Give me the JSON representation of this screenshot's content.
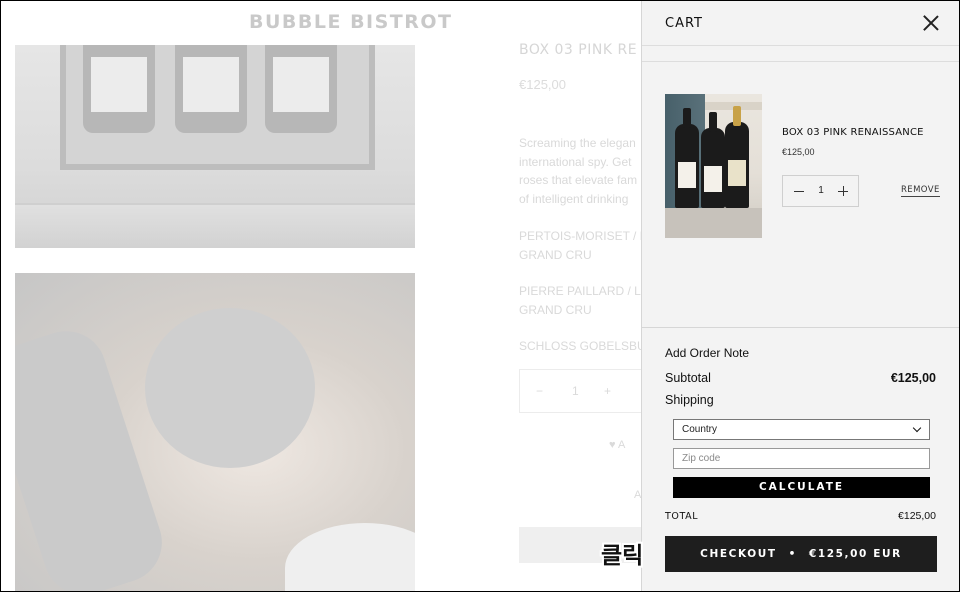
{
  "page": {
    "brand": "BUBBLE BISTROT",
    "product_title": "BOX 03 PINK RE",
    "product_price": "€125,00",
    "description_lines": [
      "Screaming the elegan",
      "international spy. Get",
      "roses that elevate fam",
      "of intelligent drinking"
    ],
    "wines": [
      {
        "line1": "PERTOIS-MORISET / L",
        "line2": "GRAND CRU"
      },
      {
        "line1": "PIERRE PAILLARD / L",
        "line2": "GRAND CRU"
      },
      {
        "line1": "SCHLOSS GOBELSBU",
        "line2": ""
      }
    ],
    "stepper": {
      "minus": "−",
      "value": "1",
      "plus": "+"
    },
    "ghost_text_1": "♥ A",
    "ghost_text_2": "A"
  },
  "overlay": {
    "click_label": "클릭"
  },
  "cart": {
    "title": "CART",
    "item": {
      "name": "BOX 03 PINK RENAISSANCE",
      "price": "€125,00",
      "quantity": "1",
      "remove_label": "REMOVE"
    },
    "order_note_label": "Add Order Note",
    "subtotal_label": "Subtotal",
    "subtotal_value": "€125,00",
    "shipping_label": "Shipping",
    "country_selected": "Country",
    "zip_placeholder": "Zip code",
    "calculate_label": "CALCULATE",
    "total_label": "TOTAL",
    "total_value": "€125,00",
    "checkout": {
      "label": "CHECKOUT",
      "separator": "•",
      "amount": "€125,00 EUR"
    }
  },
  "colors": {
    "checkout_bg": "#1e1e1e",
    "calculate_bg": "#000000",
    "drawer_bg": "#f3f3f3"
  }
}
